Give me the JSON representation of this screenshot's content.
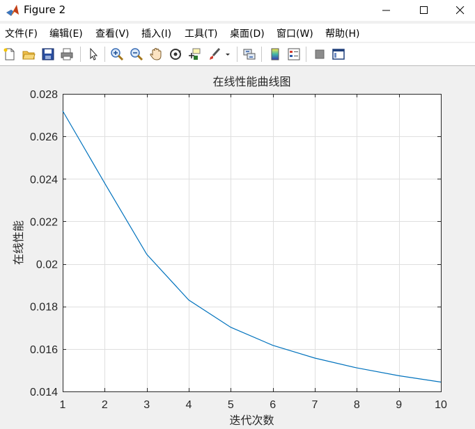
{
  "window": {
    "title": "Figure 2"
  },
  "menu": [
    {
      "label": "文件(F)"
    },
    {
      "label": "编辑(E)"
    },
    {
      "label": "查看(V)"
    },
    {
      "label": "插入(I)"
    },
    {
      "label": "工具(T)"
    },
    {
      "label": "桌面(D)"
    },
    {
      "label": "窗口(W)"
    },
    {
      "label": "帮助(H)"
    }
  ],
  "toolbar": {
    "icons": [
      "new-figure-icon",
      "open-file-icon",
      "save-icon",
      "print-icon",
      "select-arrow-icon",
      "zoom-in-icon",
      "zoom-out-icon",
      "pan-hand-icon",
      "rotate-3d-icon",
      "data-cursor-icon",
      "brush-icon",
      "brush-dropdown-icon",
      "link-plot-icon",
      "colorbar-icon",
      "legend-icon",
      "hide-plot-tools-icon",
      "show-plot-tools-icon"
    ]
  },
  "chart_data": {
    "type": "line",
    "title": "在线性能曲线图",
    "xlabel": "迭代次数",
    "ylabel": "在线性能",
    "xlim": [
      1,
      10
    ],
    "ylim": [
      0.014,
      0.028
    ],
    "grid": true,
    "x_ticks": [
      "1",
      "2",
      "3",
      "4",
      "5",
      "6",
      "7",
      "8",
      "9",
      "10"
    ],
    "y_ticks": [
      "0.014",
      "0.016",
      "0.018",
      "0.02",
      "0.022",
      "0.024",
      "0.026",
      "0.028"
    ],
    "series": [
      {
        "color": "#0072bd",
        "x": [
          1,
          2,
          3,
          4,
          5,
          6,
          7,
          8,
          9,
          10
        ],
        "y": [
          0.0272,
          0.0238,
          0.02045,
          0.0183,
          0.01702,
          0.01617,
          0.01557,
          0.01511,
          0.01474,
          0.01444
        ]
      }
    ]
  }
}
